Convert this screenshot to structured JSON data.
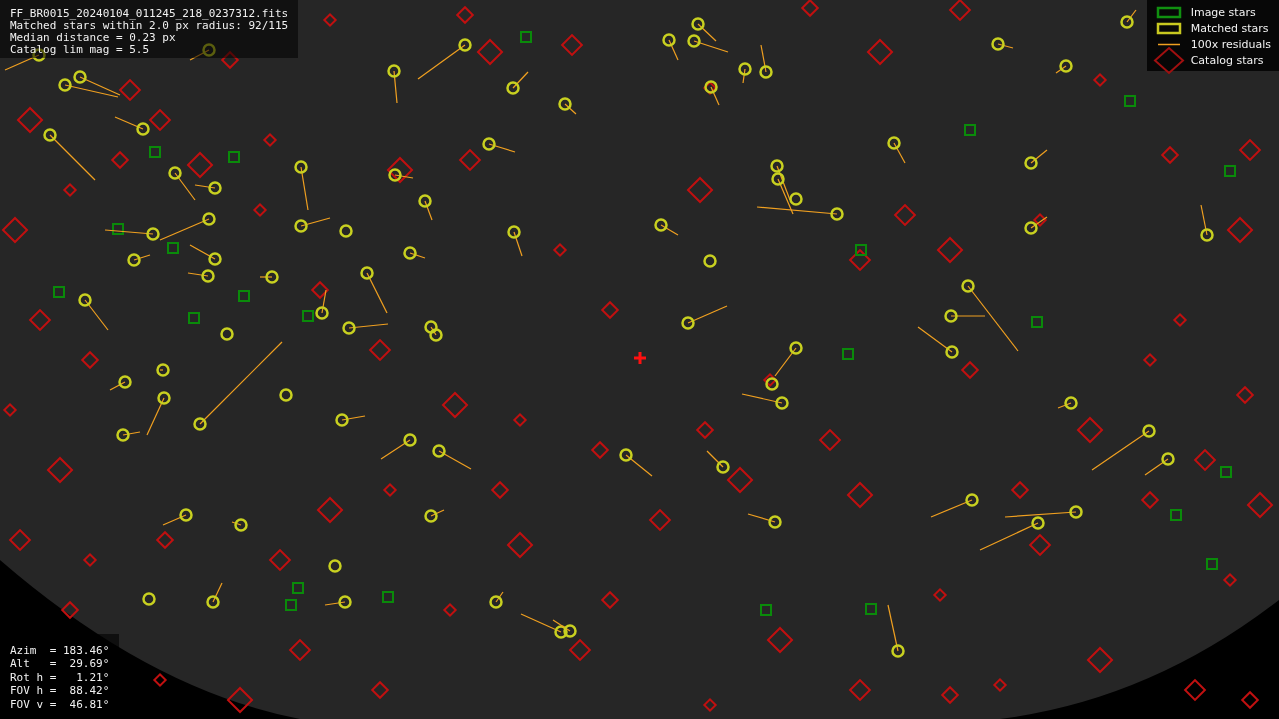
{
  "info_lines": [
    "FF_BR0015_20240104_011245_218_0237312.fits",
    "Matched stars within 2.0 px radius: 92/115",
    "Median distance = 0.23 px",
    "Catalog lim mag = 5.5"
  ],
  "legend": [
    {
      "kind": "image",
      "label": "Image stars"
    },
    {
      "kind": "matched",
      "label": "Matched stars"
    },
    {
      "kind": "residual",
      "label": "100x residuals"
    },
    {
      "kind": "catalog",
      "label": "Catalog stars"
    }
  ],
  "pointing": [
    "Azim  = 183.46°",
    "Alt   =  29.69°",
    "Rot h =   1.21°",
    "FOV h =  88.42°",
    "FOV v =  46.81°"
  ]
}
